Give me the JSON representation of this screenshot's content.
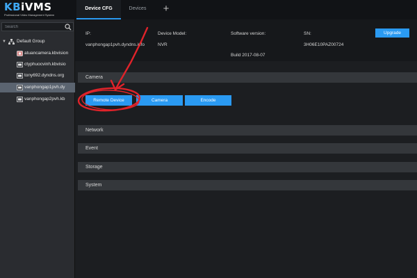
{
  "app": {
    "logo_kb": "KB",
    "logo_rest": "iVMS",
    "logo_subtitle": "Professional Video Management System"
  },
  "tabs": {
    "device_cfg": "Device CFG",
    "devices": "Devices",
    "add": "+"
  },
  "sidebar": {
    "search_placeholder": "Search",
    "group_label": "Default Group",
    "devices": [
      {
        "label": "atuancamera.kbvision"
      },
      {
        "label": "ctyphuocvinh.kbvisio"
      },
      {
        "label": "tony692.dyndns.org"
      },
      {
        "label": "vanphongap1pvh.dy"
      },
      {
        "label": "vanphongap2pvh.kb"
      }
    ]
  },
  "info": {
    "ip_label": "IP:",
    "ip_value": "vanphongap1pvh.dyndns.info",
    "model_label": "Device Model:",
    "model_value": "NVR",
    "sw_label": "Software version:",
    "build_value": "Build 2017-08-07",
    "sn_label": "SN:",
    "sn_value": "3H06E10PAZ00724",
    "upgrade_label": "Upgrade"
  },
  "sections": {
    "camera": "Camera",
    "network": "Network",
    "event": "Event",
    "storage": "Storage",
    "system": "System"
  },
  "camera_buttons": {
    "remote_device": "Remote Device",
    "camera": "Camera",
    "encode": "Encode"
  },
  "colors": {
    "accent": "#2a9af2",
    "annotation": "#e0232a",
    "selected_row": "#5b6470"
  }
}
